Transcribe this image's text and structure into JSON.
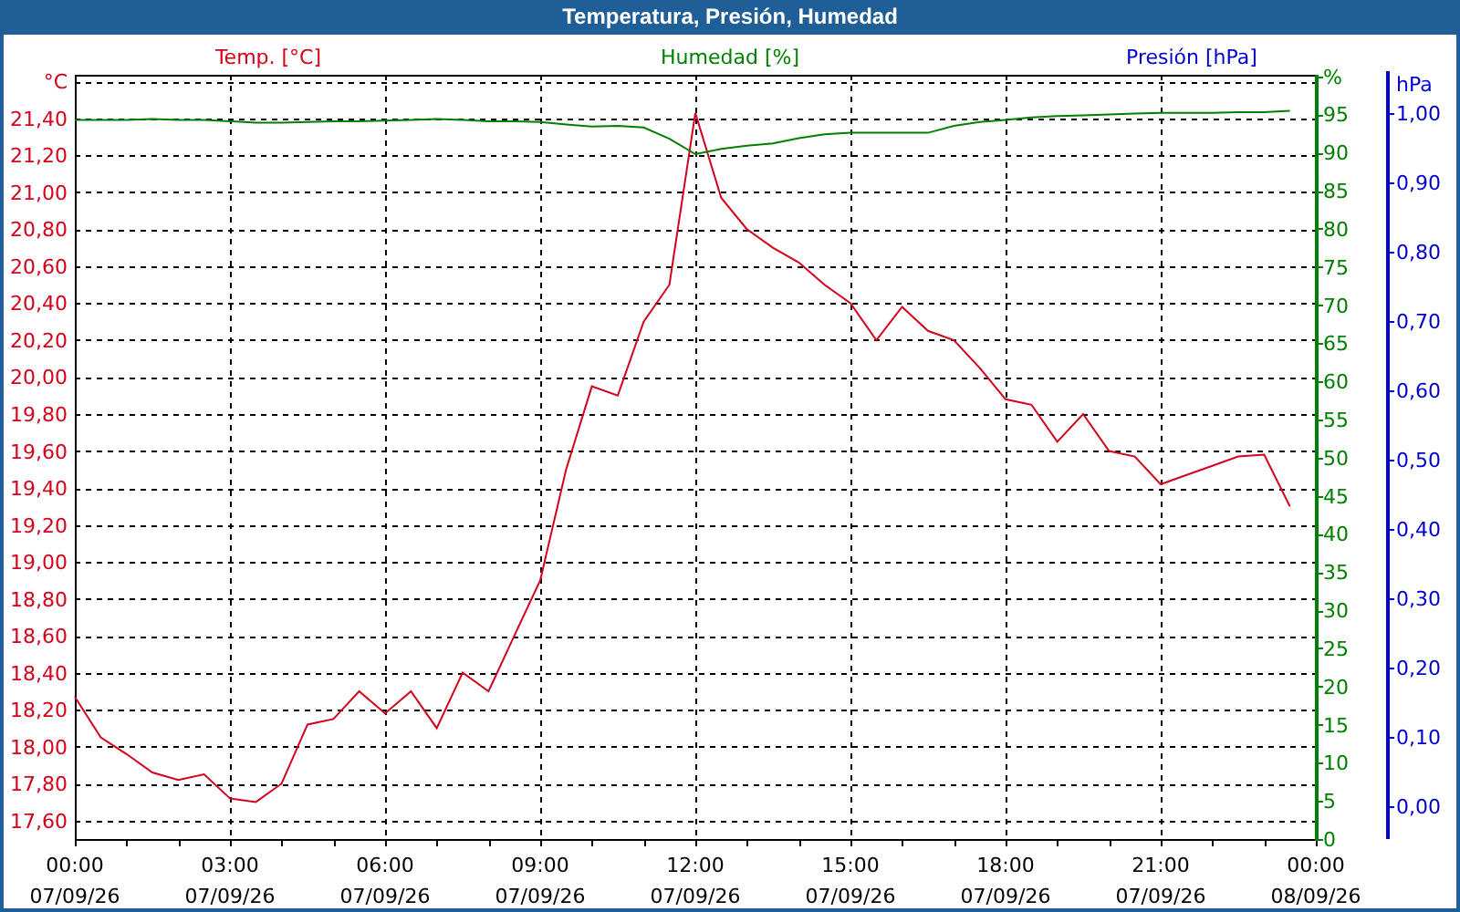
{
  "window": {
    "title": "Temperatura, Presión, Humedad"
  },
  "chart_data": {
    "type": "line",
    "grid": true,
    "categories": [
      "00:00 07/09/26",
      null,
      null,
      null,
      null,
      null,
      "03:00 07/09/26",
      null,
      null,
      null,
      null,
      null,
      "06:00 07/09/26",
      null,
      null,
      null,
      null,
      null,
      "09:00 07/09/26",
      null,
      null,
      null,
      null,
      null,
      "12:00 07/09/26",
      null,
      null,
      null,
      null,
      null,
      "15:00 07/09/26",
      null,
      null,
      null,
      null,
      null,
      "18:00 07/09/26",
      null,
      null,
      null,
      null,
      null,
      "21:00 07/09/26",
      null,
      null,
      null,
      null,
      null,
      "00:00 08/09/26"
    ],
    "ylim": [
      17.5,
      21.636
    ],
    "yticks": [
      {
        "value": 17.6,
        "label": "17,60"
      },
      {
        "value": 17.8,
        "label": "17,80"
      },
      {
        "value": 18,
        "label": "18,00"
      },
      {
        "value": 18.2,
        "label": "18,20"
      },
      {
        "value": 18.4,
        "label": "18,40"
      },
      {
        "value": 18.6,
        "label": "18,60"
      },
      {
        "value": 18.8,
        "label": "18,80"
      },
      {
        "value": 19,
        "label": "19,00"
      },
      {
        "value": 19.2,
        "label": "19,20"
      },
      {
        "value": 19.4,
        "label": "19,40"
      },
      {
        "value": 19.6,
        "label": "19,60"
      },
      {
        "value": 19.8,
        "label": "19,80"
      },
      {
        "value": 20,
        "label": "20,00"
      },
      {
        "value": 20.2,
        "label": "20,20"
      },
      {
        "value": 20.4,
        "label": "20,40"
      },
      {
        "value": 20.6,
        "label": "20,60"
      },
      {
        "value": 20.8,
        "label": "20,80"
      },
      {
        "value": 21,
        "label": "21,00"
      },
      {
        "value": 21.2,
        "label": "21,20"
      },
      {
        "value": 21.4,
        "label": "21,40"
      },
      {
        "value": 21.6,
        "label": "°C"
      }
    ],
    "y2lim": [
      0,
      100.2
    ],
    "y2ticks": [
      0,
      5,
      10,
      15,
      20,
      25,
      30,
      35,
      40,
      45,
      50,
      55,
      60,
      65,
      70,
      75,
      80,
      85,
      90,
      95,
      {
        "value": 100,
        "label": "%"
      }
    ],
    "y3label": "Presión [hPa]",
    "y3lim": [
      -0.047,
      1.055
    ],
    "y3ticks": [
      {
        "value": 0,
        "label": "0,00"
      },
      {
        "value": 0.1,
        "label": "0,10"
      },
      {
        "value": 0.2,
        "label": "0,20"
      },
      {
        "value": 0.3,
        "label": "0,30"
      },
      {
        "value": 0.4,
        "label": "0,40"
      },
      {
        "value": 0.5,
        "label": "0,50"
      },
      {
        "value": 0.6,
        "label": "0,60"
      },
      {
        "value": 0.7,
        "label": "0,70"
      },
      {
        "value": 0.8,
        "label": "0,80"
      },
      {
        "value": 0.9,
        "label": "0,90"
      },
      {
        "value": 1,
        "label": "1,00"
      },
      {
        "value": 1.042,
        "label": "hPa"
      }
    ],
    "series": [
      {
        "name": "Temp. [°C]",
        "color": "#d4001c",
        "values": [
          18.27,
          18.05,
          17.96,
          17.86,
          17.82,
          17.85,
          17.72,
          17.7,
          17.8,
          18.12,
          18.15,
          18.3,
          18.18,
          18.3,
          18.1,
          18.4,
          18.3,
          18.6,
          18.9,
          19.5,
          19.95,
          19.9,
          20.3,
          20.5,
          21.43,
          20.97,
          20.8,
          20.7,
          20.62,
          20.5,
          20.4,
          20.2,
          20.38,
          20.25,
          20.2,
          20.05,
          19.88,
          19.85,
          19.65,
          19.8,
          19.6,
          19.57,
          19.42,
          19.47,
          19.52,
          19.57,
          19.58,
          19.3,
          null
        ]
      },
      {
        "name": "Humedad [%]",
        "color": "#008000",
        "axis": "y2",
        "values": [
          94.3,
          94.3,
          94.3,
          94.4,
          94.3,
          94.3,
          94.1,
          93.9,
          93.9,
          94.0,
          94.1,
          94.1,
          94.2,
          94.3,
          94.4,
          94.3,
          94.1,
          94.1,
          94.0,
          93.7,
          93.4,
          93.5,
          93.3,
          91.8,
          89.8,
          90.5,
          90.9,
          91.2,
          91.9,
          92.4,
          92.6,
          92.6,
          92.6,
          92.6,
          93.5,
          94.0,
          94.3,
          94.6,
          94.8,
          94.9,
          95.0,
          95.1,
          95.2,
          95.2,
          95.2,
          95.3,
          95.3,
          95.5,
          null
        ]
      }
    ]
  }
}
